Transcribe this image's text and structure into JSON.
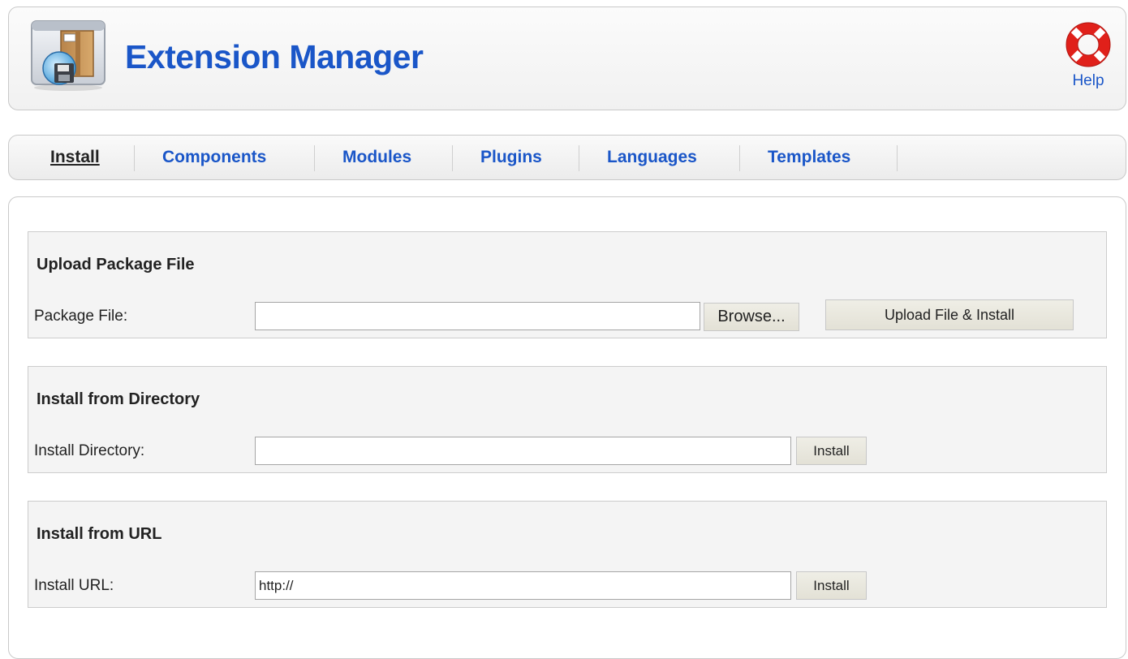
{
  "header": {
    "title": "Extension Manager",
    "help_label": "Help"
  },
  "tabs": [
    {
      "label": "Install",
      "active": true
    },
    {
      "label": "Components",
      "active": false
    },
    {
      "label": "Modules",
      "active": false
    },
    {
      "label": "Plugins",
      "active": false
    },
    {
      "label": "Languages",
      "active": false
    },
    {
      "label": "Templates",
      "active": false
    }
  ],
  "upload": {
    "title": "Upload Package File",
    "field_label": "Package File:",
    "value": "",
    "browse_label": "Browse...",
    "submit_label": "Upload File & Install"
  },
  "directory": {
    "title": "Install from Directory",
    "field_label": "Install Directory:",
    "value": "",
    "submit_label": "Install"
  },
  "url": {
    "title": "Install from URL",
    "field_label": "Install URL:",
    "value": "http://",
    "submit_label": "Install"
  },
  "icons": {
    "app": "extension-manager-icon",
    "help": "lifebuoy-icon"
  },
  "colors": {
    "link_blue": "#1a56c8",
    "help_red": "#e0201a",
    "panel_bg": "#f4f4f4",
    "button_bg": "#e9e7dd"
  }
}
